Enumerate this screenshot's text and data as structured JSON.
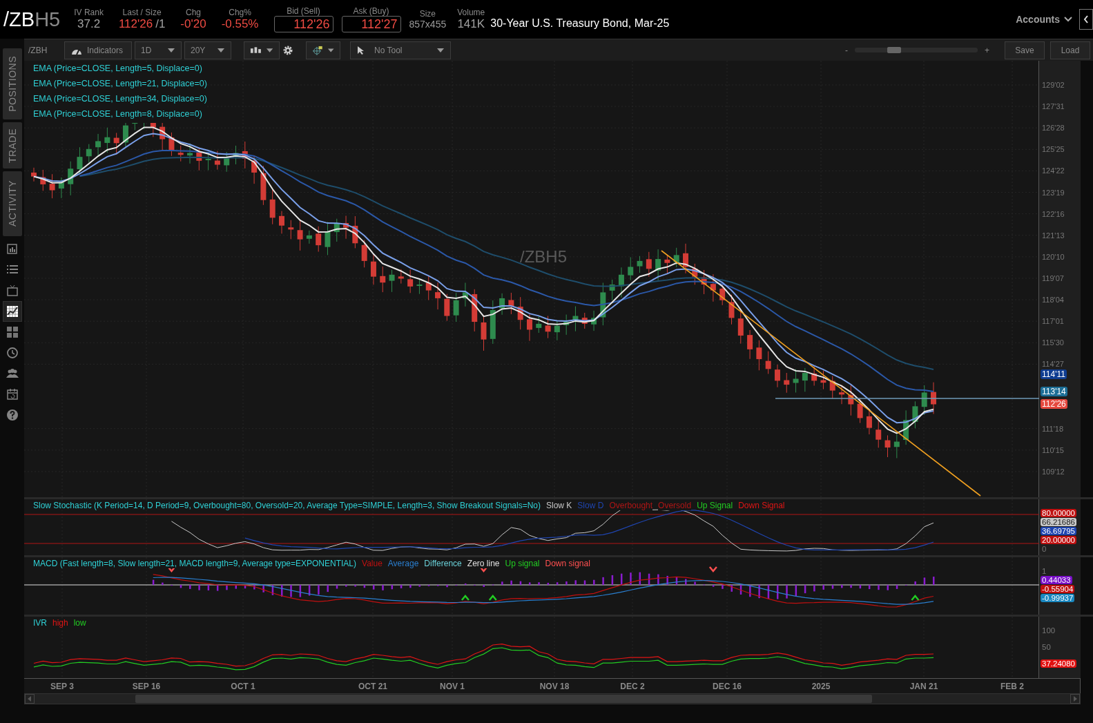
{
  "header": {
    "symbol": "/ZB",
    "symbol_suffix": "H5",
    "quotes": [
      {
        "label": "IV Rank",
        "value": "37.2",
        "kind": "plain"
      },
      {
        "label": "Last / Size",
        "value": "112'26",
        "extra": "/1",
        "kind": "last"
      },
      {
        "label": "Chg",
        "value": "-0'20",
        "kind": "change"
      },
      {
        "label": "Chg%",
        "value": "-0.55%",
        "kind": "change"
      },
      {
        "label": "Bid (Sell)",
        "value": "112'26",
        "kind": "boxed"
      },
      {
        "label": "Ask (Buy)",
        "value": "112'27",
        "kind": "boxed"
      },
      {
        "label": "Size",
        "value": "857x455",
        "kind": "small"
      },
      {
        "label": "Volume",
        "value": "141K",
        "kind": "plain"
      }
    ],
    "description": "30-Year U.S. Treasury Bond, Mar-25",
    "accounts": "Accounts"
  },
  "sidebar": {
    "tabs": [
      {
        "label": "POSITIONS"
      },
      {
        "label": "TRADE"
      },
      {
        "label": "ACTIVITY"
      }
    ],
    "icons": [
      {
        "kind": "news",
        "selected": false
      },
      {
        "kind": "list",
        "selected": false
      },
      {
        "kind": "tv",
        "selected": false
      },
      {
        "kind": "chart",
        "selected": true
      },
      {
        "kind": "grid",
        "selected": false
      },
      {
        "kind": "clock",
        "selected": false
      },
      {
        "kind": "people",
        "selected": false
      },
      {
        "kind": "calendar",
        "selected": false
      },
      {
        "kind": "help",
        "selected": false
      }
    ]
  },
  "toolbar": {
    "symbol": "/ZBH",
    "indicators": "Indicators",
    "aggregation": "1D",
    "timeframe": "20Y",
    "tool": "No Tool",
    "zoom": {
      "minus": "-",
      "plus": "+",
      "level": 0.3
    },
    "buttons": [
      "Save",
      "Load"
    ]
  },
  "price_chart": {
    "legend": [
      "EMA (Price=CLOSE, Length=5, Displace=0)",
      "EMA (Price=CLOSE, Length=21, Displace=0)",
      "EMA (Price=CLOSE, Length=34, Displace=0)",
      "EMA (Price=CLOSE, Length=8, Displace=0)"
    ],
    "watermark": "/ZBH5",
    "yticks": [
      "129'02",
      "127'31",
      "126'28",
      "125'25",
      "124'22",
      "123'19",
      "122'16",
      "121'13",
      "120'10",
      "119'07",
      "118'04",
      "117'01",
      "115'30",
      "114'27",
      "111'18",
      "110'15",
      "109'12"
    ],
    "price_tags": [
      {
        "value": "114'11",
        "color": "#0f3d91"
      },
      {
        "value": "113'14",
        "color": "#1c6e96"
      },
      {
        "value": "112'26",
        "color": "#e5483e"
      }
    ]
  },
  "stochastic": {
    "title": "Slow Stochastic (K Period=14, D Period=9, Overbought=80, Oversold=20, Average Type=SIMPLE, Length=3, Show Breakout Signals=No)",
    "series": [
      {
        "text": "Slow K",
        "color": "#c8c8c8"
      },
      {
        "text": "Slow D",
        "color": "#1f45b0"
      },
      {
        "text": "Overbought",
        "color": "#b01515"
      },
      {
        "text": "Oversold",
        "color": "#b01515"
      },
      {
        "text": "Up Signal",
        "color": "#22cc22"
      },
      {
        "text": "Down Signal",
        "color": "#e01515"
      }
    ],
    "axis": [
      {
        "text": "80.00000",
        "color": "#c01010"
      },
      {
        "text": "66.21686",
        "color": "#c8c8c8"
      },
      {
        "text": "36.69795",
        "color": "#1f45b0"
      },
      {
        "text": "20.00000",
        "color": "#c01010"
      },
      {
        "text": "0"
      }
    ]
  },
  "macd": {
    "title": "MACD (Fast length=8, Slow length=21, MACD length=9, Average type=EXPONENTIAL)",
    "series": [
      {
        "text": "Value",
        "color": "#c01010"
      },
      {
        "text": "Average",
        "color": "#2a7fd0"
      },
      {
        "text": "Difference",
        "color": "#6ad0d8"
      },
      {
        "text": "Zero line",
        "color": "#e0e0e0"
      },
      {
        "text": "Up signal",
        "color": "#22cc22"
      },
      {
        "text": "Down signal",
        "color": "#ff5050"
      }
    ],
    "axis": [
      {
        "text": "1"
      },
      {
        "text": "0.44033",
        "color": "#7a10c8"
      },
      {
        "text": "-0.55904",
        "color": "#c01010"
      },
      {
        "text": "-0.99937",
        "color": "#1a88c0"
      }
    ]
  },
  "ivr": {
    "title": "IVR",
    "series": [
      {
        "text": "high",
        "color": "#e01515"
      },
      {
        "text": "low",
        "color": "#22cc22"
      }
    ],
    "axis": [
      {
        "text": "100"
      },
      {
        "text": "50"
      },
      {
        "text": "37.24080",
        "color": "#e01010"
      }
    ]
  },
  "time_axis": [
    "SEP 3",
    "SEP 16",
    "OCT 1",
    "OCT 21",
    "NOV 1",
    "NOV 18",
    "DEC 2",
    "DEC 16",
    "2025",
    "JAN 21",
    "FEB 2"
  ]
}
